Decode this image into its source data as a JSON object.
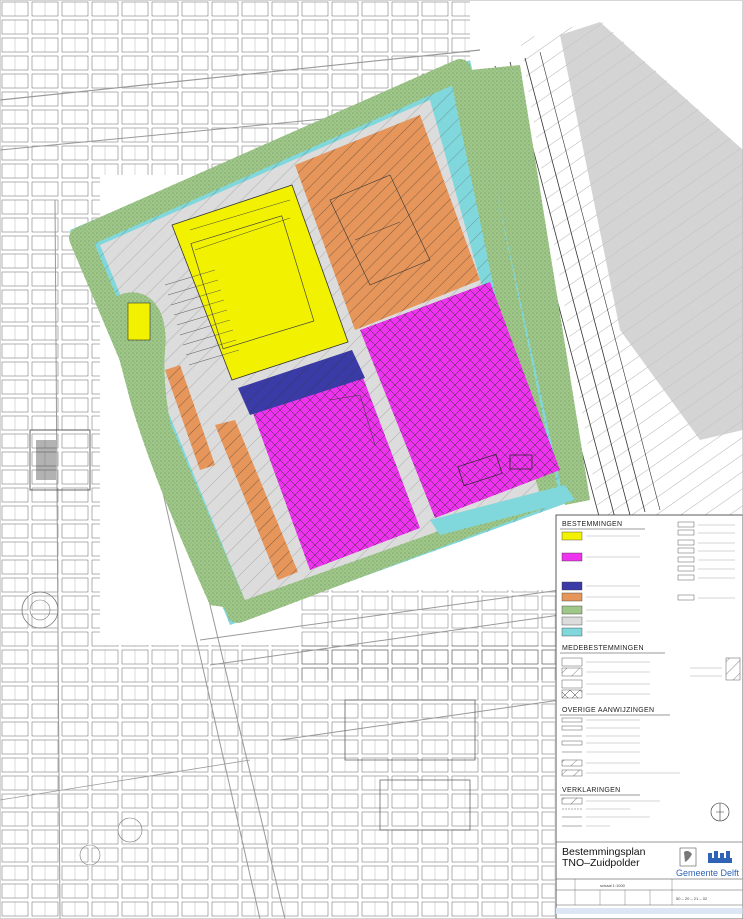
{
  "legend": {
    "sections": [
      {
        "key": "bestemmingen",
        "title": "BESTEMMINGEN"
      },
      {
        "key": "medebestemmingen",
        "title": "MEDEBESTEMMINGEN"
      },
      {
        "key": "overige",
        "title": "OVERIGE AANWIJZINGEN"
      },
      {
        "key": "verklaringen",
        "title": "VERKLARINGEN"
      }
    ]
  },
  "title_block": {
    "line1": "Bestemmingsplan",
    "line2": "TNO–Zuidpolder",
    "municipality": "Gemeente Delft",
    "scale": "schaal 1:1000",
    "sheet_number": "50 – 20 – 21 – 02"
  },
  "colors": {
    "wonen_yellow": "#f2f200",
    "bedrijf_magenta": "#ee33ee",
    "horeca_orange": "#e6965a",
    "groen_green": "#9fc789",
    "water_cyan": "#80d8dc",
    "purple_band": "#3b3ba8",
    "road_grey": "#d7d7d7",
    "rail_grey": "#c6c6c6",
    "municipality_blue": "#2f63b6"
  }
}
